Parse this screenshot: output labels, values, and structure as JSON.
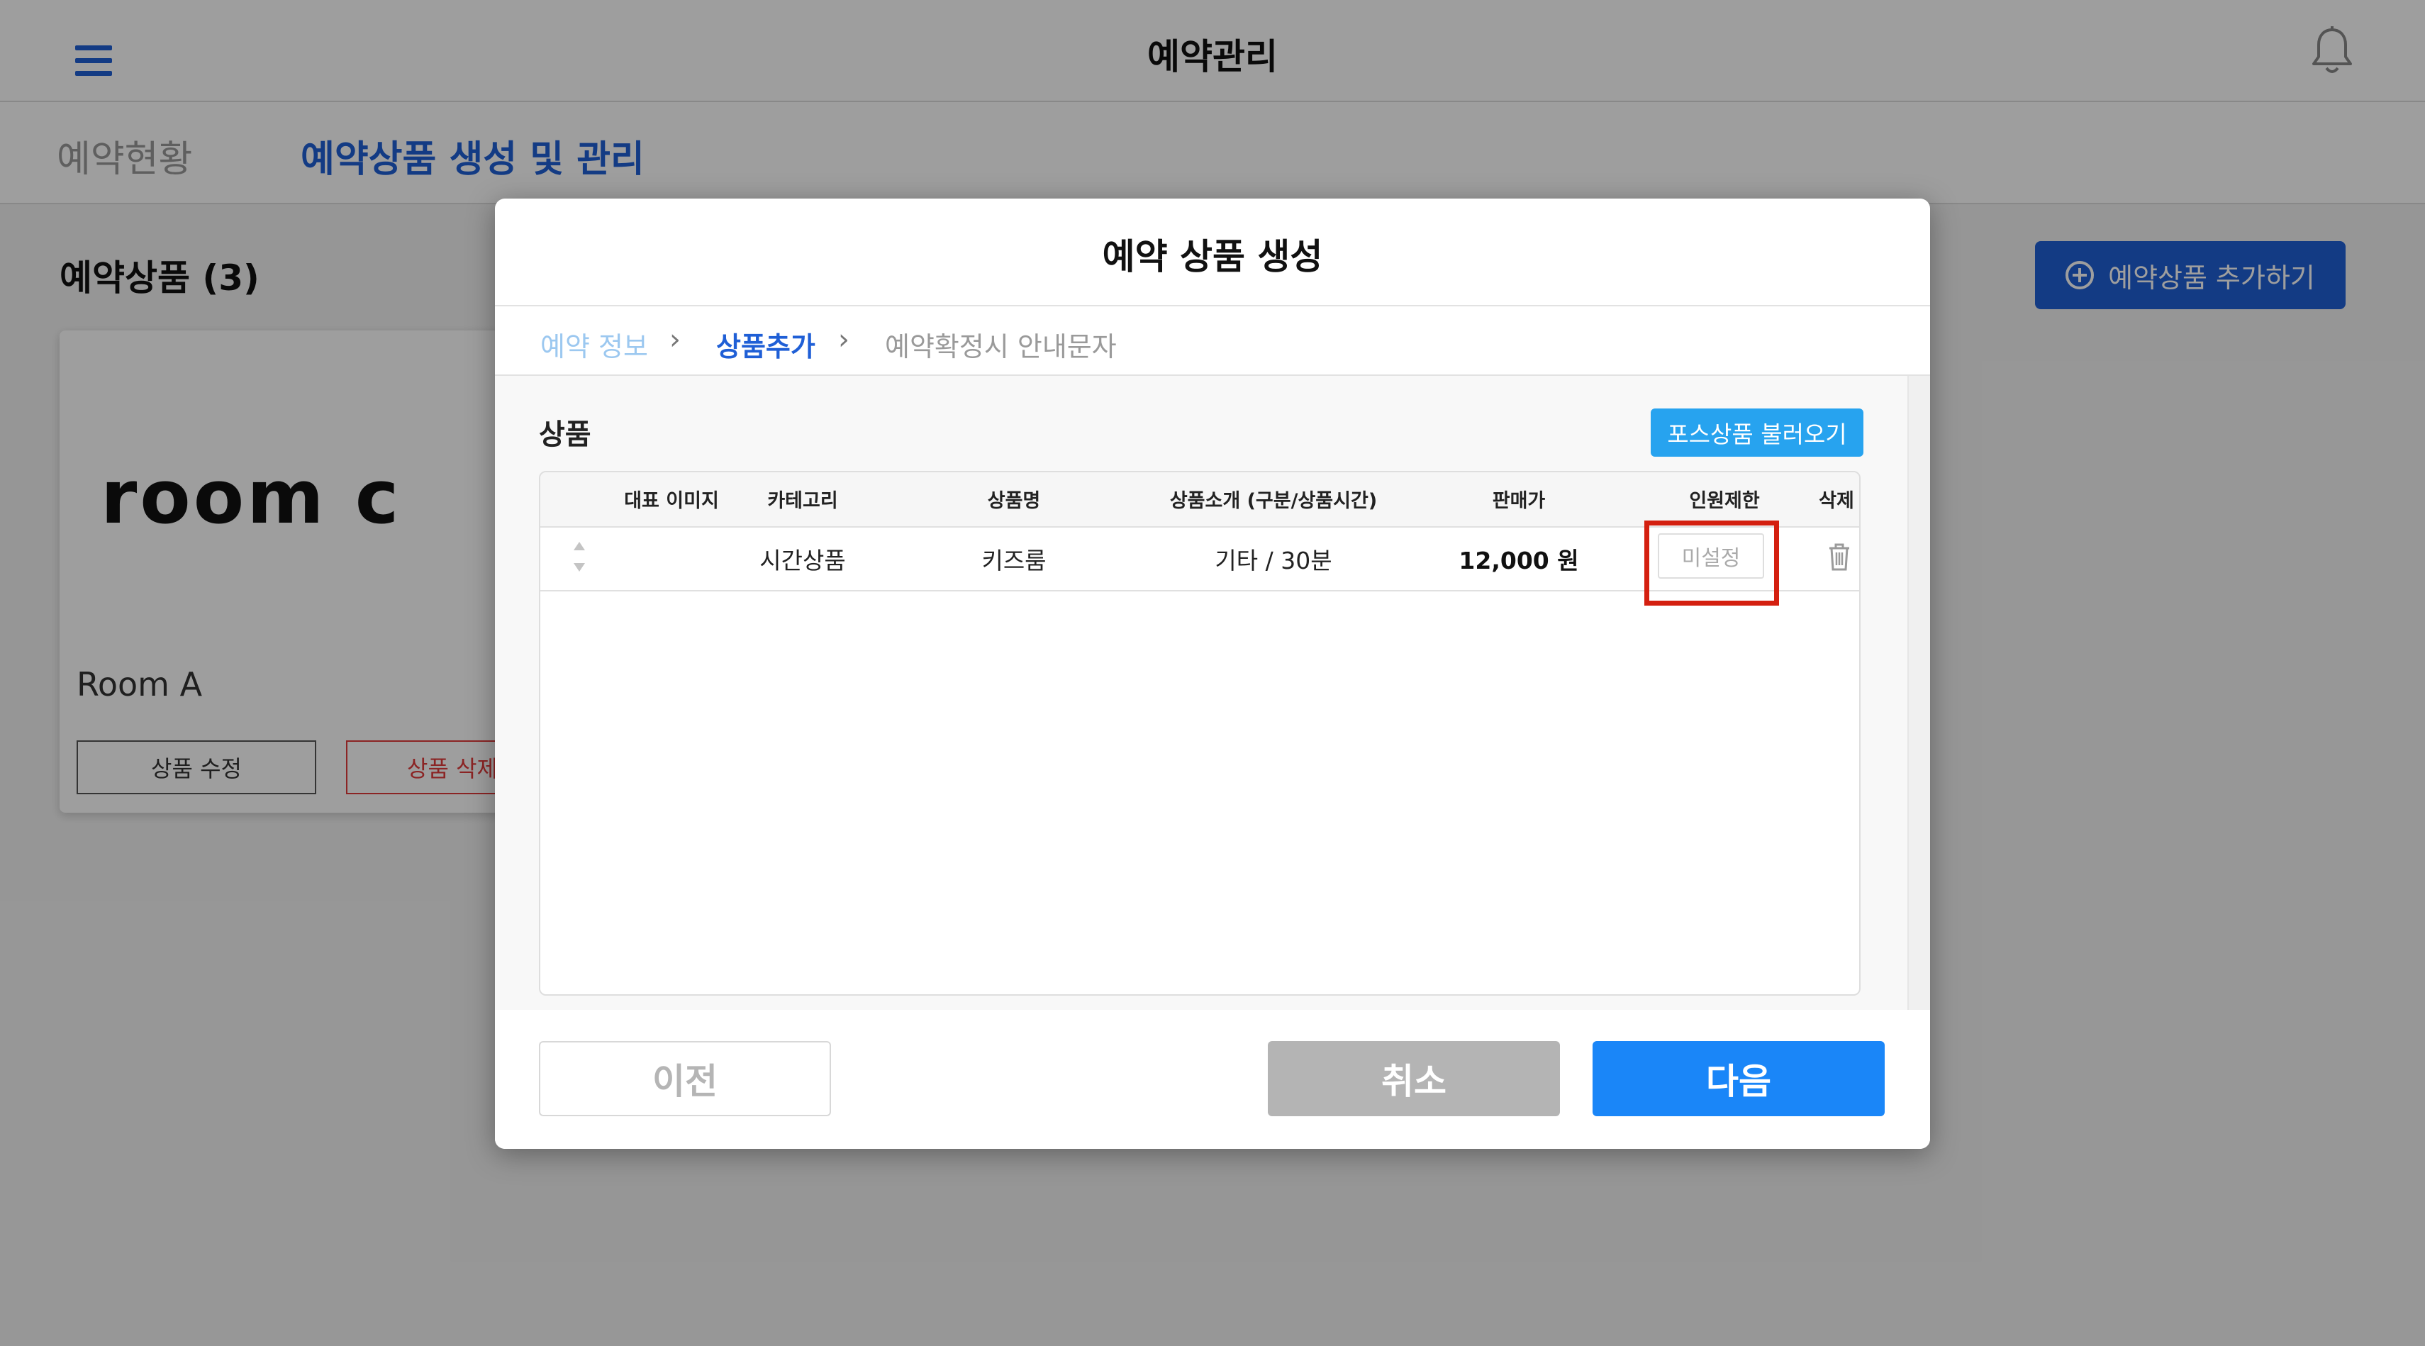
{
  "header": {
    "title": "예약관리"
  },
  "tabs": [
    {
      "label": "예약현황"
    },
    {
      "label": "예약상품 생성 및 관리"
    }
  ],
  "page": {
    "products_heading": "예약상품 (3)",
    "add_button": "예약상품 추가하기"
  },
  "card": {
    "logo_text": "room c",
    "name": "Room A",
    "edit_button": "상품 수정",
    "delete_button": "상품 삭제"
  },
  "modal": {
    "title": "예약 상품 생성",
    "steps": [
      {
        "label": "예약 정보"
      },
      {
        "label": "상품추가"
      },
      {
        "label": "예약확정시 안내문자"
      }
    ],
    "section_title": "상품",
    "pos_import_button": "포스상품 불러오기",
    "table": {
      "columns": [
        "대표 이미지",
        "카테고리",
        "상품명",
        "상품소개 (구분/상품시간)",
        "판매가",
        "인원제한",
        "삭제"
      ],
      "rows": [
        {
          "category": "시간상품",
          "name": "키즈룸",
          "intro": "기타 / 30분",
          "price": "12,000 원",
          "capacity": "미설정"
        }
      ]
    },
    "buttons": {
      "prev": "이전",
      "cancel": "취소",
      "next": "다음"
    }
  },
  "colors": {
    "brand_blue": "#1f5fd6",
    "import_blue": "#27a3ef",
    "next_blue": "#1a86f8",
    "highlight_red": "#d42010",
    "cancel_gray": "#b4b4b4"
  },
  "icons": [
    "hamburger-menu-icon",
    "bell-icon",
    "plus-circle-icon",
    "chevron-right-icon",
    "drag-handle-icon",
    "trash-icon"
  ]
}
